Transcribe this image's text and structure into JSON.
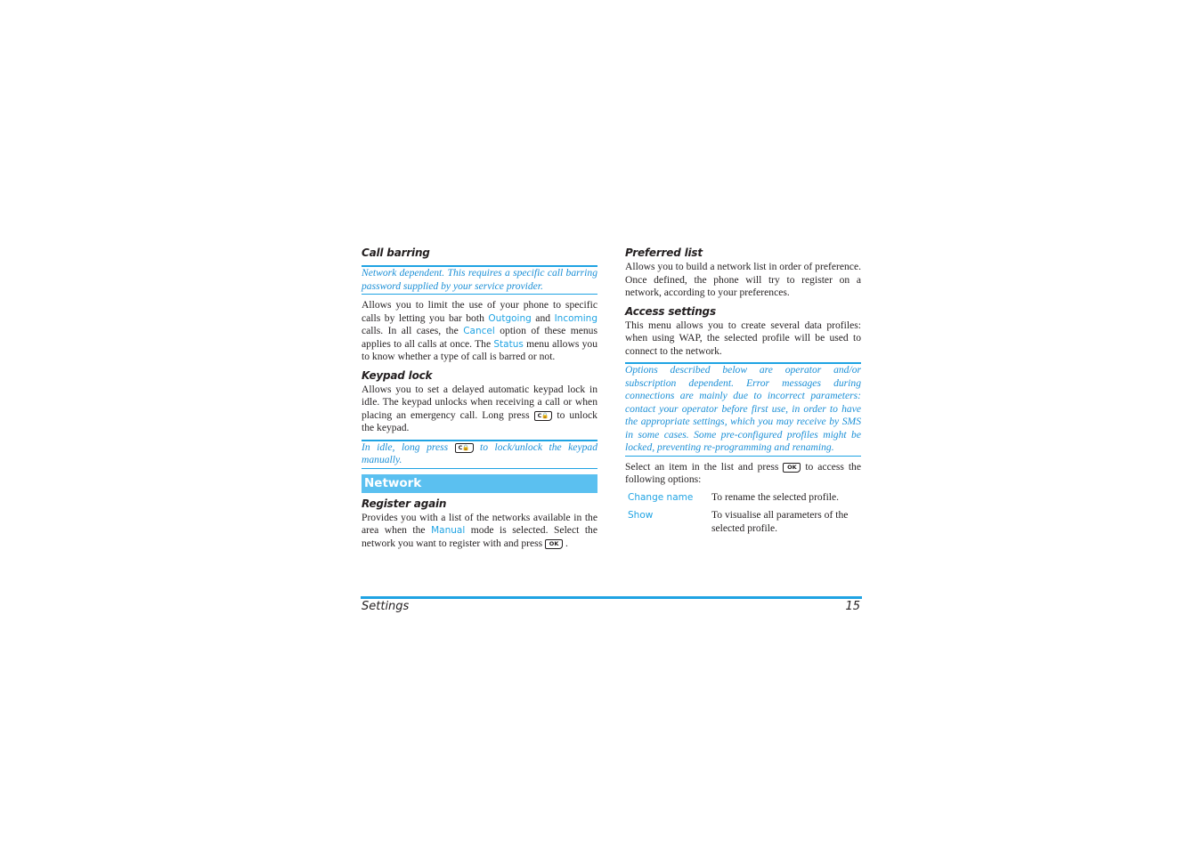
{
  "left_column": {
    "call_barring": {
      "heading": "Call barring",
      "note": "Network dependent. This requires a specific call barring password supplied by your service provider.",
      "body_parts": {
        "t1": "Allows you to limit the use of your phone to specific calls by letting you bar both ",
        "kw1": "Outgoing",
        "t2": " and ",
        "kw2": "Incoming",
        "t3": " calls. In all cases, the ",
        "kw3": "Cancel",
        "t4": " option of these menus applies to all calls at once. The ",
        "kw4": "Status",
        "t5": " menu allows you to know whether a type of call is barred or not."
      }
    },
    "keypad_lock": {
      "heading": "Keypad lock",
      "body_parts": {
        "t1": "Allows you to set a delayed automatic keypad lock in idle. The keypad unlocks when receiving a call or when placing an emergency call. Long press ",
        "key": "C\u0000",
        "t2": " to unlock the keypad."
      },
      "key_label": "c 🔒",
      "note_parts": {
        "t1": "In idle, long press ",
        "t2": " to lock/unlock the keypad manually."
      }
    },
    "network_section": {
      "title": "Network"
    },
    "register_again": {
      "heading": "Register again",
      "body_parts": {
        "t1": "Provides you with a list of the networks available in the area when the ",
        "kw1": "Manual",
        "t2": " mode is selected. Select the network you want to register with and press ",
        "t3": " ."
      }
    }
  },
  "right_column": {
    "preferred_list": {
      "heading": "Preferred list",
      "body": "Allows you to build a network list in order of preference. Once defined, the phone will try to register on a network, according to your preferences."
    },
    "access_settings": {
      "heading": "Access settings",
      "body": "This menu allows you to create several data profiles: when using WAP, the selected profile will be used to connect to the network.",
      "note": "Options described below are operator and/or subscription dependent. Error messages during connections are mainly due to incorrect parameters: contact your operator before first use, in order to have the appropriate settings, which you may receive by SMS in some cases. Some pre-configured profiles might be locked, preventing re-programming and renaming.",
      "select_parts": {
        "t1": "Select an item in the list and press ",
        "t2": " to access the following options:"
      },
      "options": [
        {
          "name": "Change name",
          "description": "To rename the selected profile."
        },
        {
          "name": "Show",
          "description": "To visualise all parameters of the selected profile."
        }
      ]
    }
  },
  "keys": {
    "ok": "OK",
    "clear_lock": "C🔒"
  },
  "footer": {
    "section": "Settings",
    "page_number": "15"
  },
  "colors": {
    "accent": "#1fa3e3",
    "banner": "#5bc0f0",
    "text": "#231f20"
  }
}
